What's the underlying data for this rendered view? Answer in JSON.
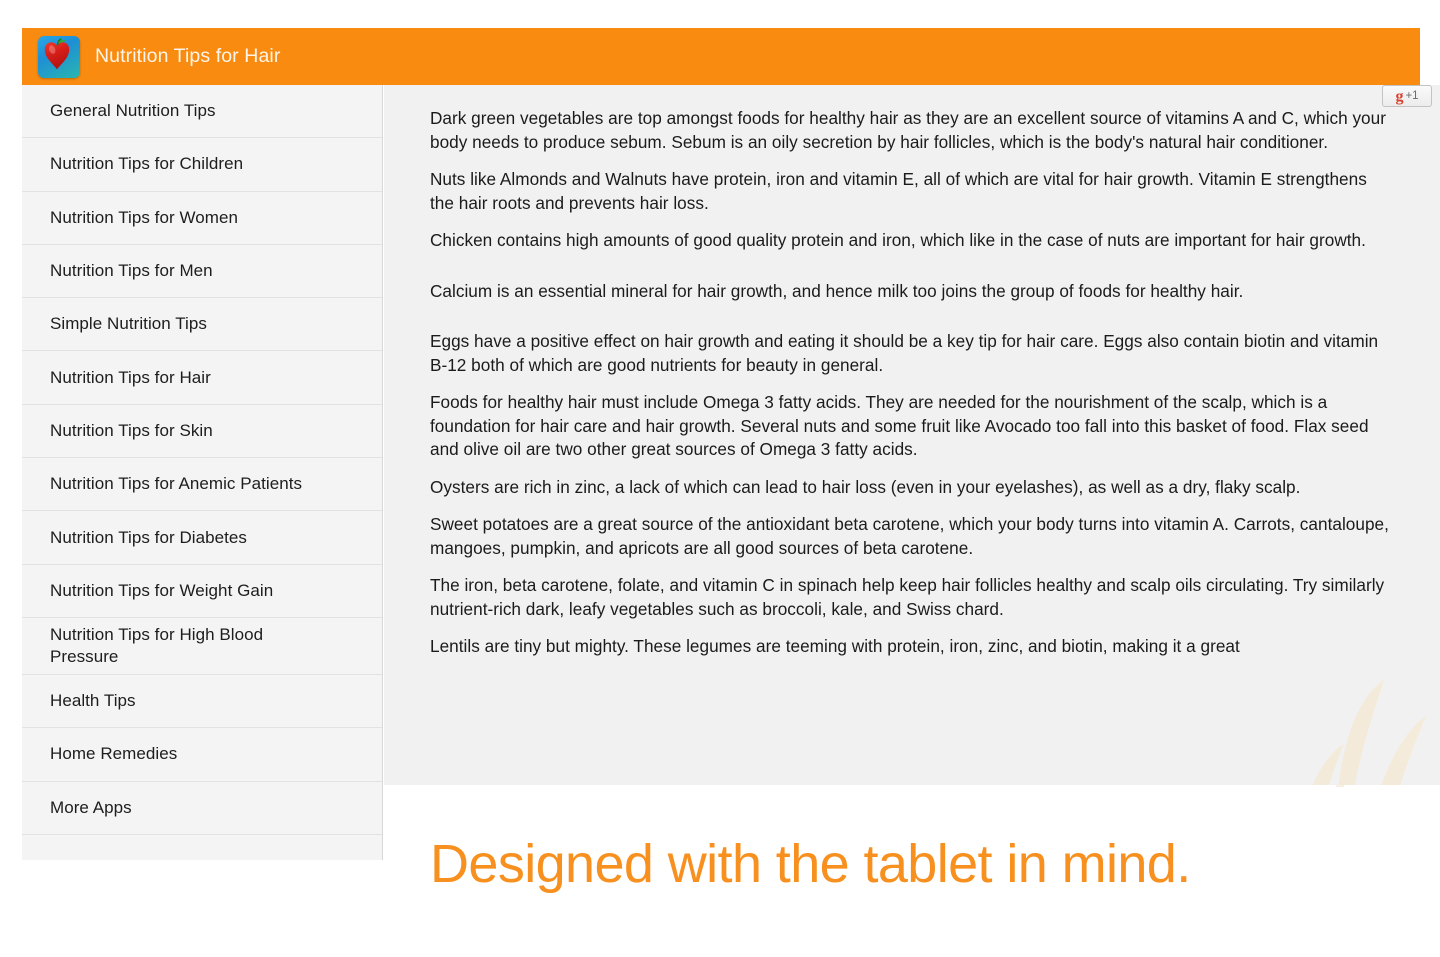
{
  "app": {
    "title": "Nutrition Tips for Hair",
    "icon_name": "apple-heart-icon",
    "accent_color": "#f98c10",
    "tagline_color": "#f7901e"
  },
  "sidebar": {
    "items": [
      {
        "label": "General Nutrition Tips"
      },
      {
        "label": "Nutrition Tips for Children"
      },
      {
        "label": "Nutrition Tips for Women"
      },
      {
        "label": "Nutrition Tips for Men"
      },
      {
        "label": "Simple Nutrition Tips"
      },
      {
        "label": "Nutrition Tips for Hair"
      },
      {
        "label": "Nutrition Tips for Skin"
      },
      {
        "label": "Nutrition Tips for Anemic Patients"
      },
      {
        "label": "Nutrition Tips for Diabetes"
      },
      {
        "label": "Nutrition Tips for Weight Gain"
      },
      {
        "label": "Nutrition Tips for High Blood Pressure"
      },
      {
        "label": "Health Tips"
      },
      {
        "label": "Home Remedies"
      },
      {
        "label": "More Apps"
      }
    ]
  },
  "gplus": {
    "logo": "g",
    "count_label": "+1"
  },
  "content": {
    "paragraphs": [
      "Dark green vegetables are top amongst foods for healthy hair as they are an excellent source of vitamins A and C, which your body needs to produce sebum. Sebum is an oily secretion by hair follicles, which is the body's natural hair conditioner.",
      "Nuts like Almonds and Walnuts have protein, iron and vitamin E, all of which are vital for hair growth. Vitamin E strengthens the hair roots and prevents hair loss.",
      "Chicken contains high amounts of good quality protein and iron, which like in the case of nuts are important for hair growth.",
      "Calcium is an essential mineral for hair growth, and hence milk too joins the group of foods for healthy hair.",
      "Eggs have a positive effect on hair growth and eating it should be a key tip for hair care. Eggs also contain biotin and vitamin B-12 both of which are good nutrients for beauty in general.",
      "Foods for healthy hair must include Omega 3 fatty acids. They are needed for the nourishment of the scalp, which is a foundation for hair care and hair growth. Several nuts and some fruit like Avocado too fall into this basket of food. Flax seed and olive oil are two other great sources of Omega 3 fatty acids.",
      "Oysters are rich in zinc, a lack of which can lead to hair loss (even in your eyelashes), as well as a dry, flaky scalp.",
      "Sweet potatoes are a great source of the antioxidant beta carotene, which your body turns into vitamin A. Carrots, cantaloupe, mangoes, pumpkin, and apricots are all good sources of beta carotene.",
      "The iron, beta carotene, folate, and vitamin C in spinach help keep hair follicles healthy and scalp oils circulating. Try similarly nutrient-rich dark, leafy vegetables such as broccoli, kale, and Swiss chard.",
      "Lentils are tiny but mighty. These legumes are teeming with protein, iron, zinc, and biotin, making it a great"
    ]
  },
  "promo": {
    "tagline": "Designed with the tablet in mind."
  }
}
